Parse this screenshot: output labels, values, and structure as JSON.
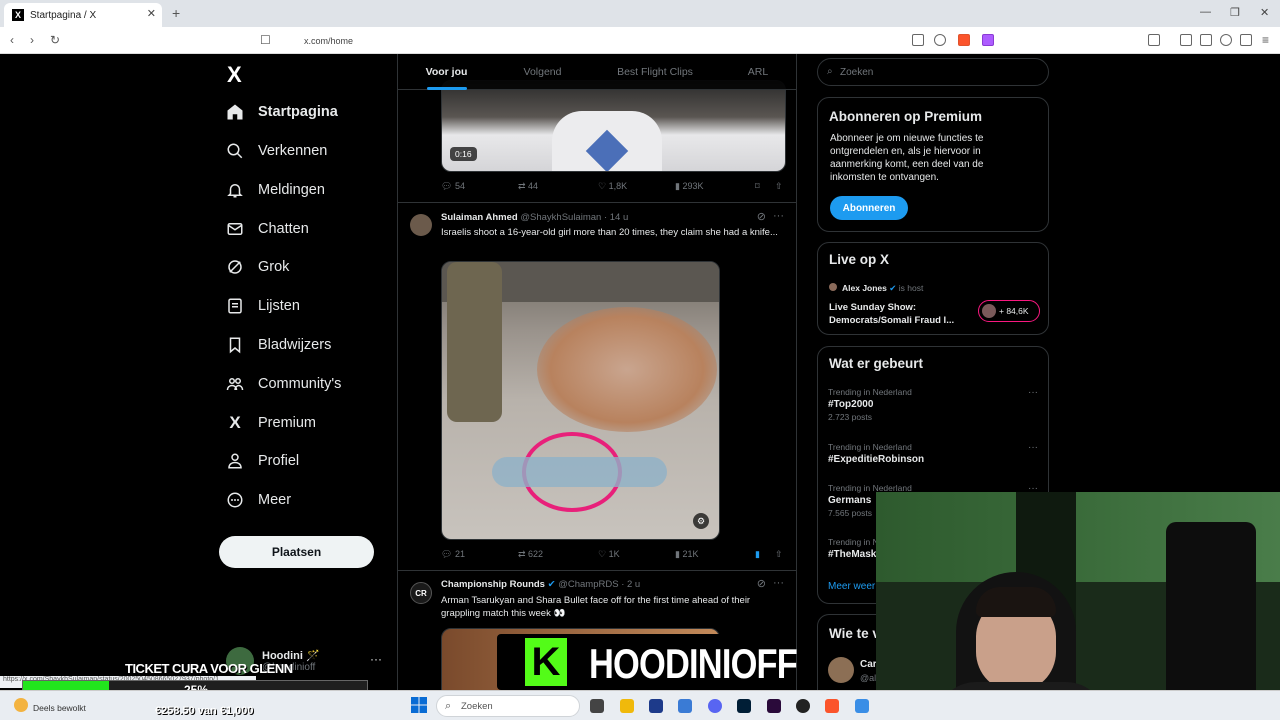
{
  "browser": {
    "tab_title": "Startpagina / X",
    "url": "x.com/home",
    "new_tab_symbol": "+",
    "close_symbol": "✕"
  },
  "sidebar": {
    "logo": "X",
    "items": [
      {
        "label": "Startpagina",
        "icon": "home-icon",
        "active": true
      },
      {
        "label": "Verkennen",
        "icon": "search-icon"
      },
      {
        "label": "Meldingen",
        "icon": "bell-icon"
      },
      {
        "label": "Chatten",
        "icon": "mail-icon"
      },
      {
        "label": "Grok",
        "icon": "grok-icon"
      },
      {
        "label": "Lijsten",
        "icon": "list-icon"
      },
      {
        "label": "Bladwijzers",
        "icon": "bookmark-icon"
      },
      {
        "label": "Community's",
        "icon": "community-icon"
      },
      {
        "label": "Premium",
        "icon": "x-premium-icon"
      },
      {
        "label": "Profiel",
        "icon": "person-icon"
      },
      {
        "label": "Meer",
        "icon": "more-circle-icon"
      }
    ],
    "post_button": "Plaatsen",
    "profile": {
      "name": "Hoodini 🪄",
      "handle": "@hoodinioff"
    }
  },
  "feed": {
    "tabs": [
      "Voor jou",
      "Volgend",
      "Best Flight Clips",
      "ARL"
    ],
    "active_tab": "Voor jou",
    "tweets": [
      {
        "video_duration": "0:16",
        "stats": {
          "replies": "54",
          "reposts": "44",
          "likes": "1,8K",
          "views": "293K"
        }
      },
      {
        "author": "Sulaiman Ahmed",
        "handle": "@ShaykhSulaiman",
        "time": "· 14 u",
        "text": "Israelis shoot a 16-year-old girl more than 20 times, they claim she had a knife...",
        "stats": {
          "replies": "21",
          "reposts": "622",
          "likes": "1K",
          "views": "21K"
        }
      },
      {
        "author": "Championship Rounds",
        "handle": "@ChampRDS",
        "time": "· 2 u",
        "text": "Arman Tsarukyan and Shara Bullet face off for the first time ahead of their grappling match this week 👀",
        "avatar_text": "CR"
      }
    ]
  },
  "right": {
    "search_placeholder": "Zoeken",
    "premium": {
      "title": "Abonneren op Premium",
      "body": "Abonneer je om nieuwe functies te ontgrendelen en, als je hiervoor in aanmerking komt, een deel van de inkomsten te ontvangen.",
      "button": "Abonneren"
    },
    "live": {
      "title": "Live op X",
      "host": "Alex Jones",
      "host_role": "is host",
      "show": "Live Sunday Show: Democrats/Somali Fraud I...",
      "listeners": "+ 84,6K"
    },
    "trending": {
      "title": "Wat er gebeurt",
      "items": [
        {
          "context": "Trending in Nederland",
          "topic": "#Top2000",
          "posts": "2.723 posts"
        },
        {
          "context": "Trending in Nederland",
          "topic": "#ExpeditieRobinson",
          "posts": ""
        },
        {
          "context": "Trending in Nederland",
          "topic": "Germans",
          "posts": "7.565 posts"
        },
        {
          "context": "Trending in N",
          "topic": "#TheMask",
          "posts": ""
        }
      ],
      "more": "Meer weer"
    },
    "who_to_follow": {
      "title": "Wie te v",
      "name": "Car",
      "handle": "@al"
    }
  },
  "overlay": {
    "ticket_text": "TICKET CURA VOOR GLENN",
    "percent": "25%",
    "progress": 0.25,
    "goal": "€258.50 van €1,000",
    "banner_text": "HOODINIOFF",
    "banner_logo": "K",
    "status_url": "https://x.com/ShaykhSulaiman/status/2002504508665027937/photo/1"
  },
  "taskbar": {
    "weather": "Deels bewolkt",
    "search": "Zoeken"
  }
}
